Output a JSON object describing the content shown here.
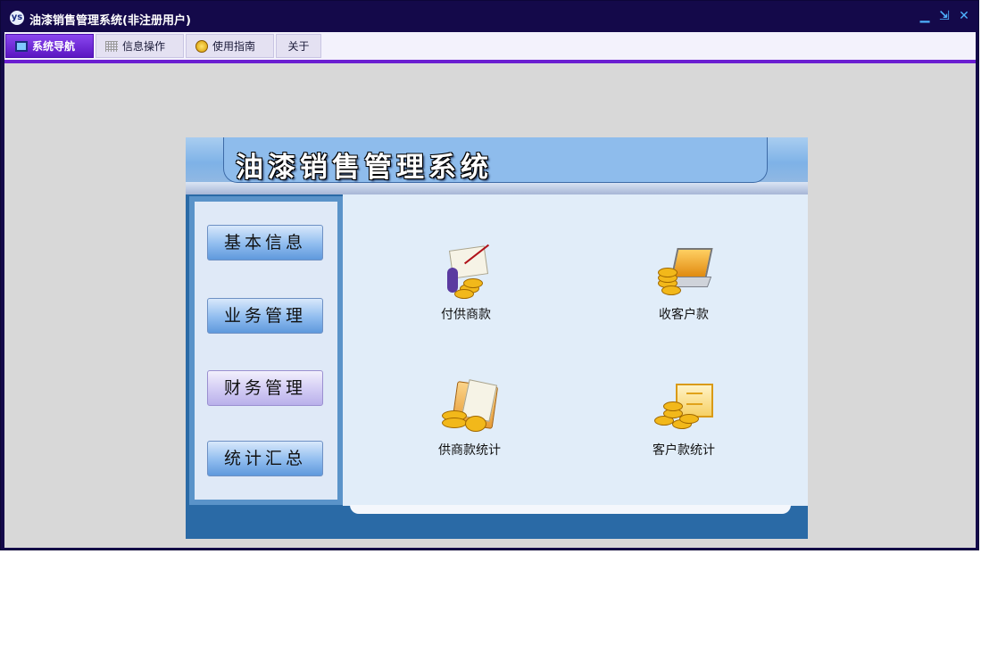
{
  "window": {
    "title": "油漆销售管理系统(非注册用户)",
    "controls": {
      "minimize": "▁",
      "restore": "⇲",
      "close": "✕"
    },
    "accent": "#6a1ed1",
    "titlebar_color": "#14094a"
  },
  "tabs": [
    {
      "label": "系统导航",
      "icon": "monitor-icon",
      "active": true
    },
    {
      "label": "信息操作",
      "icon": "grid-icon",
      "active": false
    },
    {
      "label": "使用指南",
      "icon": "guide-icon",
      "active": false
    },
    {
      "label": "关于",
      "icon": "",
      "active": false
    }
  ],
  "panel": {
    "title": "油漆销售管理系统",
    "nav": [
      {
        "label": "基本信息",
        "active": false
      },
      {
        "label": "业务管理",
        "active": false
      },
      {
        "label": "财务管理",
        "active": true
      },
      {
        "label": "统计汇总",
        "active": false
      }
    ],
    "tiles": [
      {
        "label": "付供商款",
        "icon": "payment-chart-icon"
      },
      {
        "label": "收客户款",
        "icon": "coins-laptop-icon"
      },
      {
        "label": "供商款统计",
        "icon": "folder-coins-icon"
      },
      {
        "label": "客户款统计",
        "icon": "coins-screen-icon"
      }
    ]
  }
}
